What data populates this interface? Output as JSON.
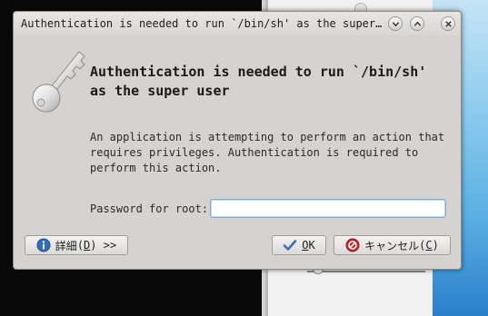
{
  "dialog": {
    "title": "Authentication is needed to run `/bin/sh' as the super…",
    "heading_line1": "Authentication is needed to run `/bin/sh'",
    "heading_line2": "as the super user",
    "description_line1": "An application is attempting to perform an action that",
    "description_line2": "requires privileges. Authentication is required to",
    "description_line3": "perform this action.",
    "password_label": "Password for root:",
    "password_value": "",
    "titlebar_buttons": [
      "chevron-down-icon",
      "chevron-up-icon",
      "close-icon"
    ]
  },
  "buttons": {
    "details": {
      "label": "詳細",
      "mnemonic_open": "(",
      "mnemonic": "D",
      "mnemonic_close": ")",
      "suffix": " >>",
      "icon": "info-icon"
    },
    "ok": {
      "mnemonic": "O",
      "rest": "K",
      "icon": "checkmark-icon"
    },
    "cancel": {
      "label": "キャンセル",
      "mnemonic_open": "(",
      "mnemonic": "C",
      "mnemonic_close": ")",
      "icon": "cancel-icon"
    }
  },
  "colors": {
    "dialog_bg": "#d6d2d0",
    "input_focus_border": "#7aaed6",
    "info_icon": "#2f6db8",
    "cancel_icon": "#c62828",
    "ok_icon": "#3d6fb0"
  }
}
